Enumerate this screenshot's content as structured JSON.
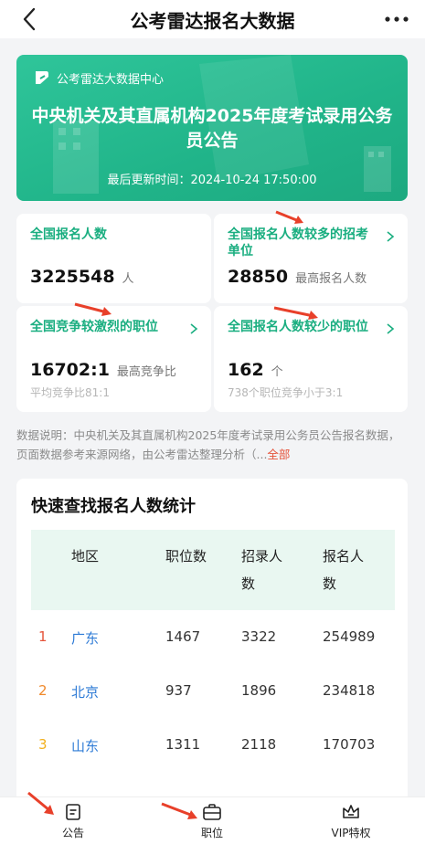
{
  "topbar": {
    "title": "公考雷达报名大数据"
  },
  "hero": {
    "brand": "公考雷达大数据中心",
    "title": "中央机关及其直属机构2025年度考试录用公务员公告",
    "updated": "最后更新时间：2024-10-24 17:50:00"
  },
  "stats": [
    {
      "label": "全国报名人数",
      "value": "3225548",
      "unit": "人"
    },
    {
      "label": "全国报名人数较多的招考单位",
      "value": "28850",
      "unit": "最高报名人数"
    },
    {
      "label": "全国竞争较激烈的职位",
      "value": "16702:1",
      "unit": "最高竞争比",
      "sub": "平均竞争比81:1"
    },
    {
      "label": "全国报名人数较少的职位",
      "value": "162",
      "unit": "个",
      "sub": "738个职位竞争小于3:1"
    }
  ],
  "description": {
    "text": "数据说明：中央机关及其直属机构2025年度考试录用公务员公告报名数据，页面数据参考来源网络，由公考雷达整理分析（...",
    "more": "全部"
  },
  "table": {
    "title": "快速查找报名人数统计",
    "headers": [
      "地区",
      "职位数",
      "招录人数",
      "报名人数"
    ],
    "rows": [
      {
        "rank": "1",
        "region": "广东",
        "positions": "1467",
        "recruits": "3322",
        "applicants": "254989",
        "rank_color": "#e5533a"
      },
      {
        "rank": "2",
        "region": "北京",
        "positions": "937",
        "recruits": "1896",
        "applicants": "234818",
        "rank_color": "#f0892b"
      },
      {
        "rank": "3",
        "region": "山东",
        "positions": "1311",
        "recruits": "2118",
        "applicants": "170703",
        "rank_color": "#f2b01e"
      }
    ]
  },
  "tabbar": {
    "tab1": "公告",
    "tab2": "职位",
    "tab3": "VIP特权"
  },
  "colors": {
    "accent": "#1aae80",
    "arrow": "#e8402a",
    "link": "#2e7bd6"
  }
}
